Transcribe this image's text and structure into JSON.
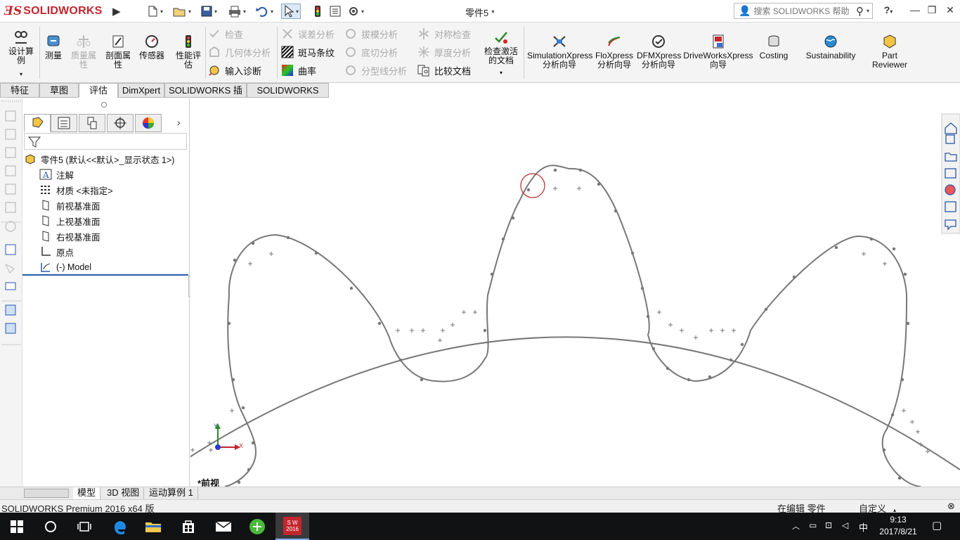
{
  "app": {
    "logo_ds": "ƎS",
    "logo_text": "SOLIDWORKS",
    "document_title": "零件5 *",
    "search_placeholder": "搜索 SOLIDWORKS 帮助",
    "help_label": "?"
  },
  "ribbon": {
    "design_study": "设计算例",
    "measure": "测量",
    "mass_properties": "质量属性",
    "section_properties": "剖面属性",
    "sensors": "传感器",
    "performance_eval": "性能评估",
    "check": "检查",
    "geometry_analysis": "几何体分析",
    "import_diagnostics": "输入诊断",
    "deviation_analysis": "误差分析",
    "zebra_stripes": "斑马条纹",
    "curvature": "曲率",
    "draft_analysis": "拔模分析",
    "undercut_analysis": "底切分析",
    "parting_line_analysis": "分型线分析",
    "symmetry_check": "对称检查",
    "thickness_analysis": "厚度分析",
    "compare_documents": "比较文档",
    "check_active_doc": "检查激活的文档",
    "simulationxpress": "SimulationXpress 分析向导",
    "floxpress": "FloXpress 分析向导",
    "dfmxpress": "DFMXpress 分析向导",
    "driveworksxpress": "DriveWorksXpress 向导",
    "costing": "Costing",
    "sustainability": "Sustainability",
    "part_reviewer": "Part Reviewer"
  },
  "command_tabs": [
    "特征",
    "草图",
    "评估",
    "DimXpert",
    "SOLIDWORKS 插件",
    "SOLIDWORKS MBD"
  ],
  "active_tab": "评估",
  "feature_tree": {
    "root": "零件5  (默认<<默认>_显示状态 1>)",
    "items": [
      "注解",
      "材质 <未指定>",
      "前视基准面",
      "上视基准面",
      "右视基准面",
      "原点",
      "(-) Model"
    ]
  },
  "viewport": {
    "view_label": "*前视",
    "triad_x": "X",
    "triad_y": "Y"
  },
  "bottom_tabs": [
    "模型",
    "3D 视图",
    "运动算例 1"
  ],
  "active_bottom_tab": "模型",
  "status": {
    "product": "SOLIDWORKS Premium 2016 x64 版",
    "editing": "在编辑 零件",
    "units": "自定义"
  },
  "taskbar": {
    "sw_badge": "2016",
    "ime": "中",
    "time": "9:13",
    "date": "2017/8/21"
  },
  "colors": {
    "brand_red": "#c4262e",
    "curve_gray": "#777777",
    "highlight_circle": "#c0282e",
    "taskbar": "#111214"
  }
}
